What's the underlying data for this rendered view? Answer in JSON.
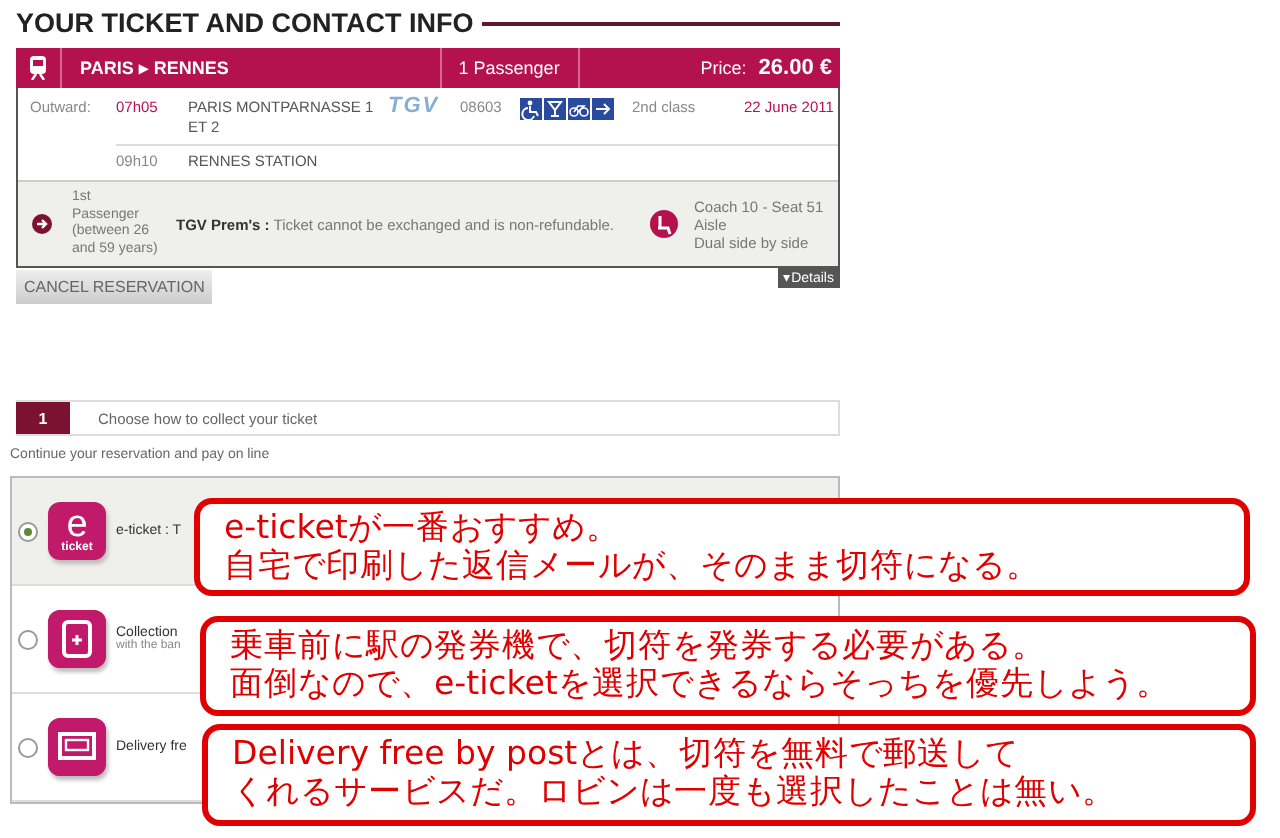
{
  "heading": "YOUR TICKET AND CONTACT INFO",
  "trip": {
    "route": "PARIS ▸ RENNES",
    "passengers": "1 Passenger",
    "price_label": "Price:",
    "price": "26.00 €"
  },
  "journey": {
    "direction": "Outward:",
    "departure_time": "07h05",
    "departure_station": "PARIS MONTPARNASSE 1 ET 2",
    "train_logo": "TGV",
    "train_number": "08603",
    "class": "2nd class",
    "date": "22 June 2011",
    "arrival_time": "09h10",
    "arrival_station": "RENNES STATION"
  },
  "passenger": {
    "ordinal": "1st",
    "label": "Passenger",
    "age": "(between 26 and 59 years)",
    "fare": "**TGV Prem's :** Ticket cannot be exchanged and is non-refundable.",
    "seat_lines": [
      "Coach 10 - Seat 51",
      "Aisle",
      "Dual side by side"
    ]
  },
  "cancel_button": "CANCEL RESERVATION",
  "details_toggle": "▾Details",
  "step": {
    "number": "1",
    "title": "Choose how to collect your ticket"
  },
  "instruction": "Continue your reservation and pay on line",
  "options": [
    {
      "kind": "eticket",
      "selected": true,
      "label": "e-ticket : T",
      "icon_letter": "e",
      "icon_caption": "ticket"
    },
    {
      "kind": "station",
      "selected": false,
      "label": "Collection",
      "sublabel": "with the ban"
    },
    {
      "kind": "post",
      "selected": false,
      "label": "Delivery fre"
    }
  ],
  "annotations": [
    {
      "lines": [
        "e-ticketが一番おすすめ。",
        "自宅で印刷した返信メールが、そのまま切符になる。"
      ]
    },
    {
      "lines": [
        "乗車前に駅の発券機で、切符を発券する必要がある。",
        "面倒なので、e-ticketを選択できるならそっちを優先しよう。"
      ]
    },
    {
      "lines": [
        "Delivery free by postとは、切符を無料で郵送して",
        "くれるサービスだ。ロビンは一度も選択したことは無い。"
      ]
    }
  ]
}
